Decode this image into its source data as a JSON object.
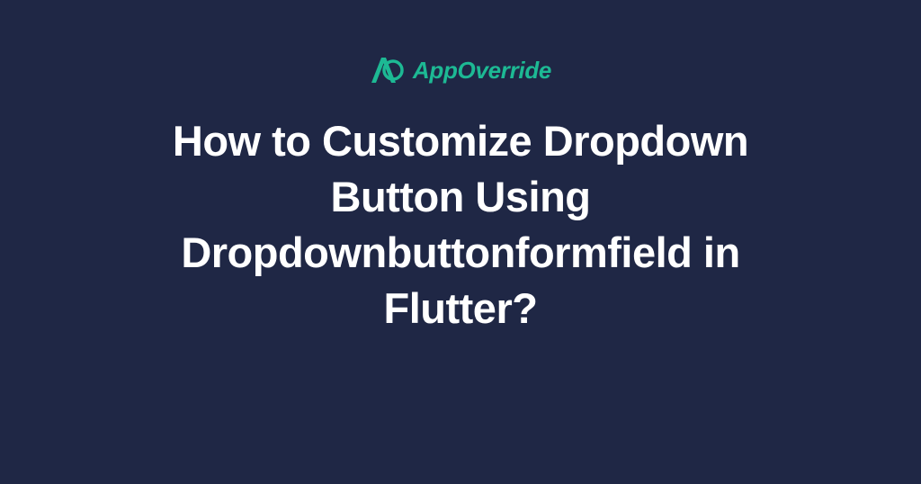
{
  "brand": {
    "name": "AppOverride",
    "accentColor": "#1db994"
  },
  "title": "How to Customize Dropdown Button Using Dropdownbuttonformfield in Flutter?"
}
